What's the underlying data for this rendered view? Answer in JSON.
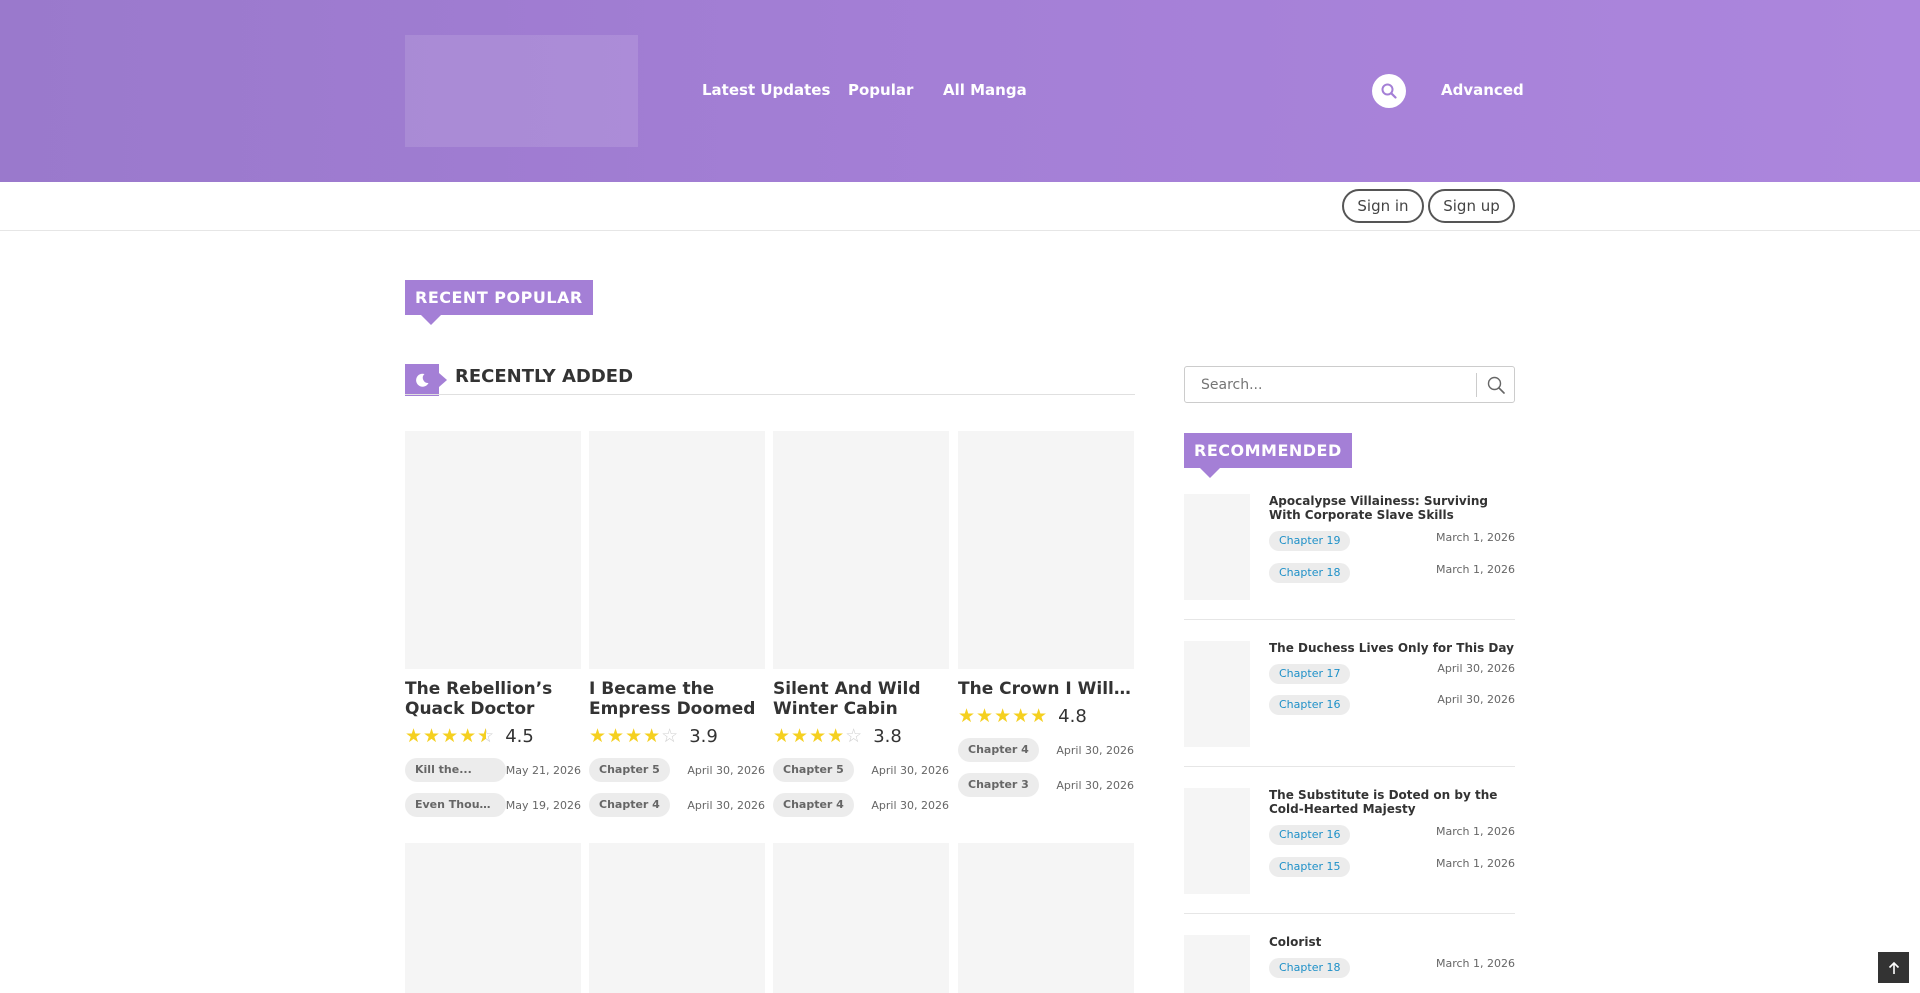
{
  "header": {
    "nav": [
      "Latest Updates",
      "Popular",
      "All Manga"
    ],
    "advanced_label": "Advanced",
    "search_icon": "search-icon"
  },
  "auth": {
    "sign_in": "Sign in",
    "sign_up": "Sign up"
  },
  "sections": {
    "recent_popular": "RECENT POPULAR",
    "recently_added": "RECENTLY ADDED",
    "recommended": "RECOMMENDED"
  },
  "colors": {
    "accent": "#a47fd6",
    "link": "#1e90c8",
    "star": "#f5d020"
  },
  "cards": [
    {
      "title": "The Rebellion’s Quack Doctor",
      "rating": 4.5,
      "rating_label": "4.5",
      "chapters": [
        {
          "label": "Kill the...",
          "date": "May 21, 2026"
        },
        {
          "label": "Even Though I...",
          "date": "May 19, 2026"
        }
      ]
    },
    {
      "title": "I Became the Empress Doomed to...",
      "rating": 3.9,
      "rating_label": "3.9",
      "chapters": [
        {
          "label": "Chapter 5",
          "date": "April 30, 2026"
        },
        {
          "label": "Chapter 4",
          "date": "April 30, 2026"
        }
      ]
    },
    {
      "title": "Silent And Wild Winter Cabin",
      "rating": 3.8,
      "rating_label": "3.8",
      "chapters": [
        {
          "label": "Chapter 5",
          "date": "April 30, 2026"
        },
        {
          "label": "Chapter 4",
          "date": "April 30, 2026"
        }
      ]
    },
    {
      "title": "The Crown I Will Seize",
      "rating": 4.8,
      "rating_label": "4.8",
      "chapters": [
        {
          "label": "Chapter 4",
          "date": "April 30, 2026"
        },
        {
          "label": "Chapter 3",
          "date": "April 30, 2026"
        }
      ]
    }
  ],
  "sidebar": {
    "search_placeholder": "Search...",
    "recommended": [
      {
        "title": "Apocalypse Villainess: Surviving With Corporate Slave Skills",
        "chapters": [
          {
            "label": "Chapter 19",
            "date": "March 1, 2026"
          },
          {
            "label": "Chapter 18",
            "date": "March 1, 2026"
          }
        ]
      },
      {
        "title": "The Duchess Lives Only for This Day",
        "chapters": [
          {
            "label": "Chapter 17",
            "date": "April 30, 2026"
          },
          {
            "label": "Chapter 16",
            "date": "April 30, 2026"
          }
        ]
      },
      {
        "title": "The Substitute is Doted on by the Cold-Hearted Majesty",
        "chapters": [
          {
            "label": "Chapter 16",
            "date": "March 1, 2026"
          },
          {
            "label": "Chapter 15",
            "date": "March 1, 2026"
          }
        ]
      },
      {
        "title": "Colorist",
        "chapters": [
          {
            "label": "Chapter 18",
            "date": "March 1, 2026"
          }
        ]
      }
    ]
  }
}
